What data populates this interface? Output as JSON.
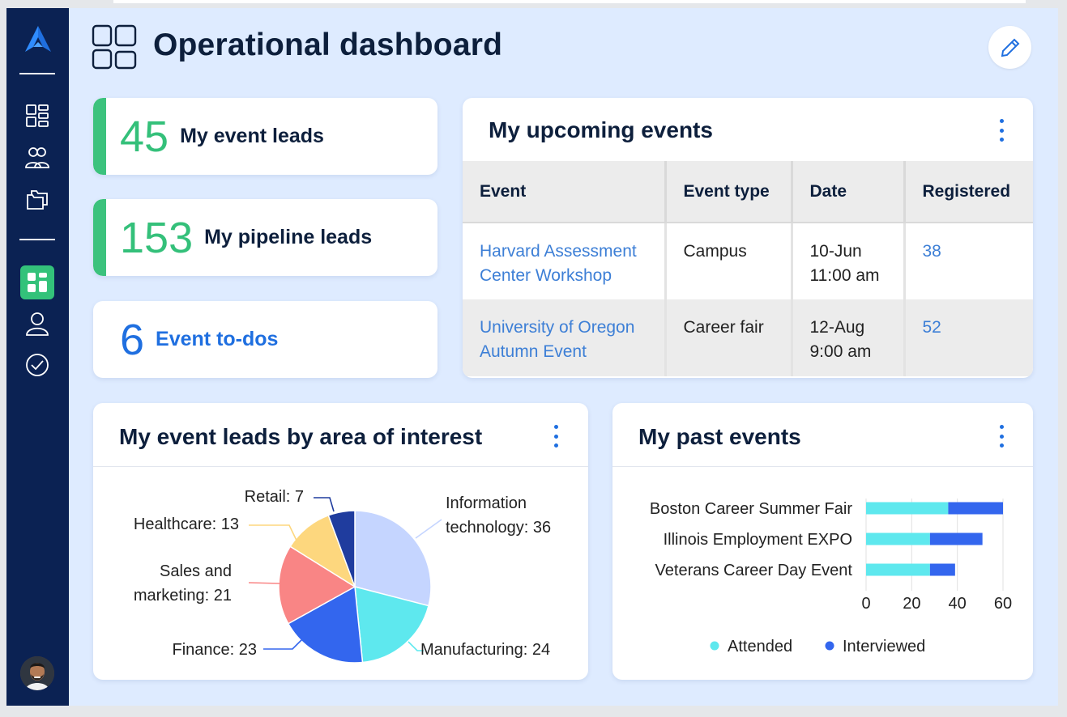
{
  "page": {
    "title": "Operational dashboard"
  },
  "sidebar": {
    "items": [
      {
        "name": "dashboard-grid-icon"
      },
      {
        "name": "people-icon"
      },
      {
        "name": "folders-icon"
      },
      {
        "name": "dashboard-active-icon"
      },
      {
        "name": "user-icon"
      },
      {
        "name": "check-circle-icon"
      }
    ],
    "accent_color": "#33c27a",
    "bg_color": "#0b2253"
  },
  "stats": [
    {
      "value": "45",
      "label": "My event leads"
    },
    {
      "value": "153",
      "label": "My pipeline leads"
    },
    {
      "value": "6",
      "label": "Event to-dos"
    }
  ],
  "upcoming": {
    "title": "My upcoming events",
    "columns": [
      "Event",
      "Event type",
      "Date",
      "Registered"
    ],
    "rows": [
      {
        "event": [
          "Harvard Assessment",
          "Center Workshop"
        ],
        "type": "Campus",
        "date": [
          "10-Jun",
          "11:00 am"
        ],
        "registered": "38"
      },
      {
        "event": [
          "University of Oregon",
          "Autumn Event"
        ],
        "type": "Career fair",
        "date": [
          "12-Aug",
          "9:00 am"
        ],
        "registered": "52"
      }
    ]
  },
  "pie_card": {
    "title": "My event leads by area of interest"
  },
  "past_card": {
    "title": "My past events"
  },
  "chart_data": [
    {
      "type": "pie",
      "title": "My event leads by area of interest",
      "slices": [
        {
          "label": "Information technology",
          "value": 36,
          "color": "#c5d5ff",
          "text_lines": [
            "Information",
            "technology: 36"
          ]
        },
        {
          "label": "Manufacturing",
          "value": 24,
          "color": "#5ee8ee",
          "text_lines": [
            "Manufacturing: 24"
          ]
        },
        {
          "label": "Finance",
          "value": 23,
          "color": "#3366ee",
          "text_lines": [
            "Finance: 23"
          ]
        },
        {
          "label": "Sales and marketing",
          "value": 21,
          "color": "#f98585",
          "text_lines": [
            "Sales and",
            "marketing: 21"
          ]
        },
        {
          "label": "Healthcare",
          "value": 13,
          "color": "#fdd77e",
          "text_lines": [
            "Healthcare: 13"
          ]
        },
        {
          "label": "Retail",
          "value": 7,
          "color": "#1f3c9e",
          "text_lines": [
            "Retail: 7"
          ]
        }
      ]
    },
    {
      "type": "bar",
      "orientation": "horizontal",
      "stacked": true,
      "title": "My past events",
      "categories": [
        "Boston Career Summer Fair",
        "Illinois Employment EXPO",
        "Veterans Career Day Event"
      ],
      "series": [
        {
          "name": "Attended",
          "values": [
            36,
            28,
            28
          ],
          "color": "#5ee8ee"
        },
        {
          "name": "Interviewed",
          "values": [
            24,
            23,
            11
          ],
          "color": "#3366ee"
        }
      ],
      "xlim": [
        0,
        60
      ],
      "xticks": [
        "0",
        "20",
        "40",
        "60"
      ],
      "grid": true,
      "legend": "bottom"
    }
  ]
}
